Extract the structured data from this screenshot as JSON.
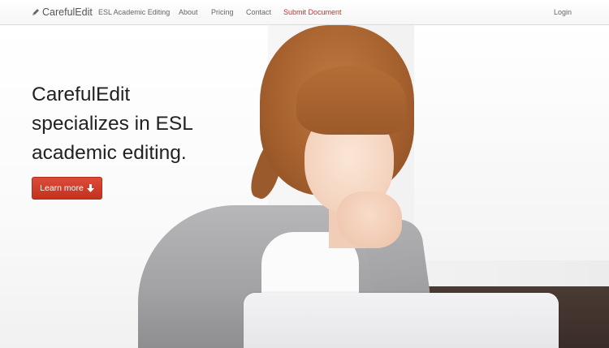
{
  "nav": {
    "brand": "CarefulEdit",
    "links": [
      {
        "label": "ESL Academic Editing"
      },
      {
        "label": "About"
      },
      {
        "label": "Pricing"
      },
      {
        "label": "Contact"
      },
      {
        "label": "Submit Document"
      }
    ],
    "login": "Login"
  },
  "hero": {
    "headline_lines": [
      "CarefulEdit",
      "specializes in ESL",
      "academic editing."
    ],
    "cta_label": "Learn more"
  },
  "colors": {
    "accent": "#c9302c",
    "button": "#d3402d"
  },
  "icons": {
    "brand": "pencil-icon",
    "cta": "arrow-down-icon"
  }
}
